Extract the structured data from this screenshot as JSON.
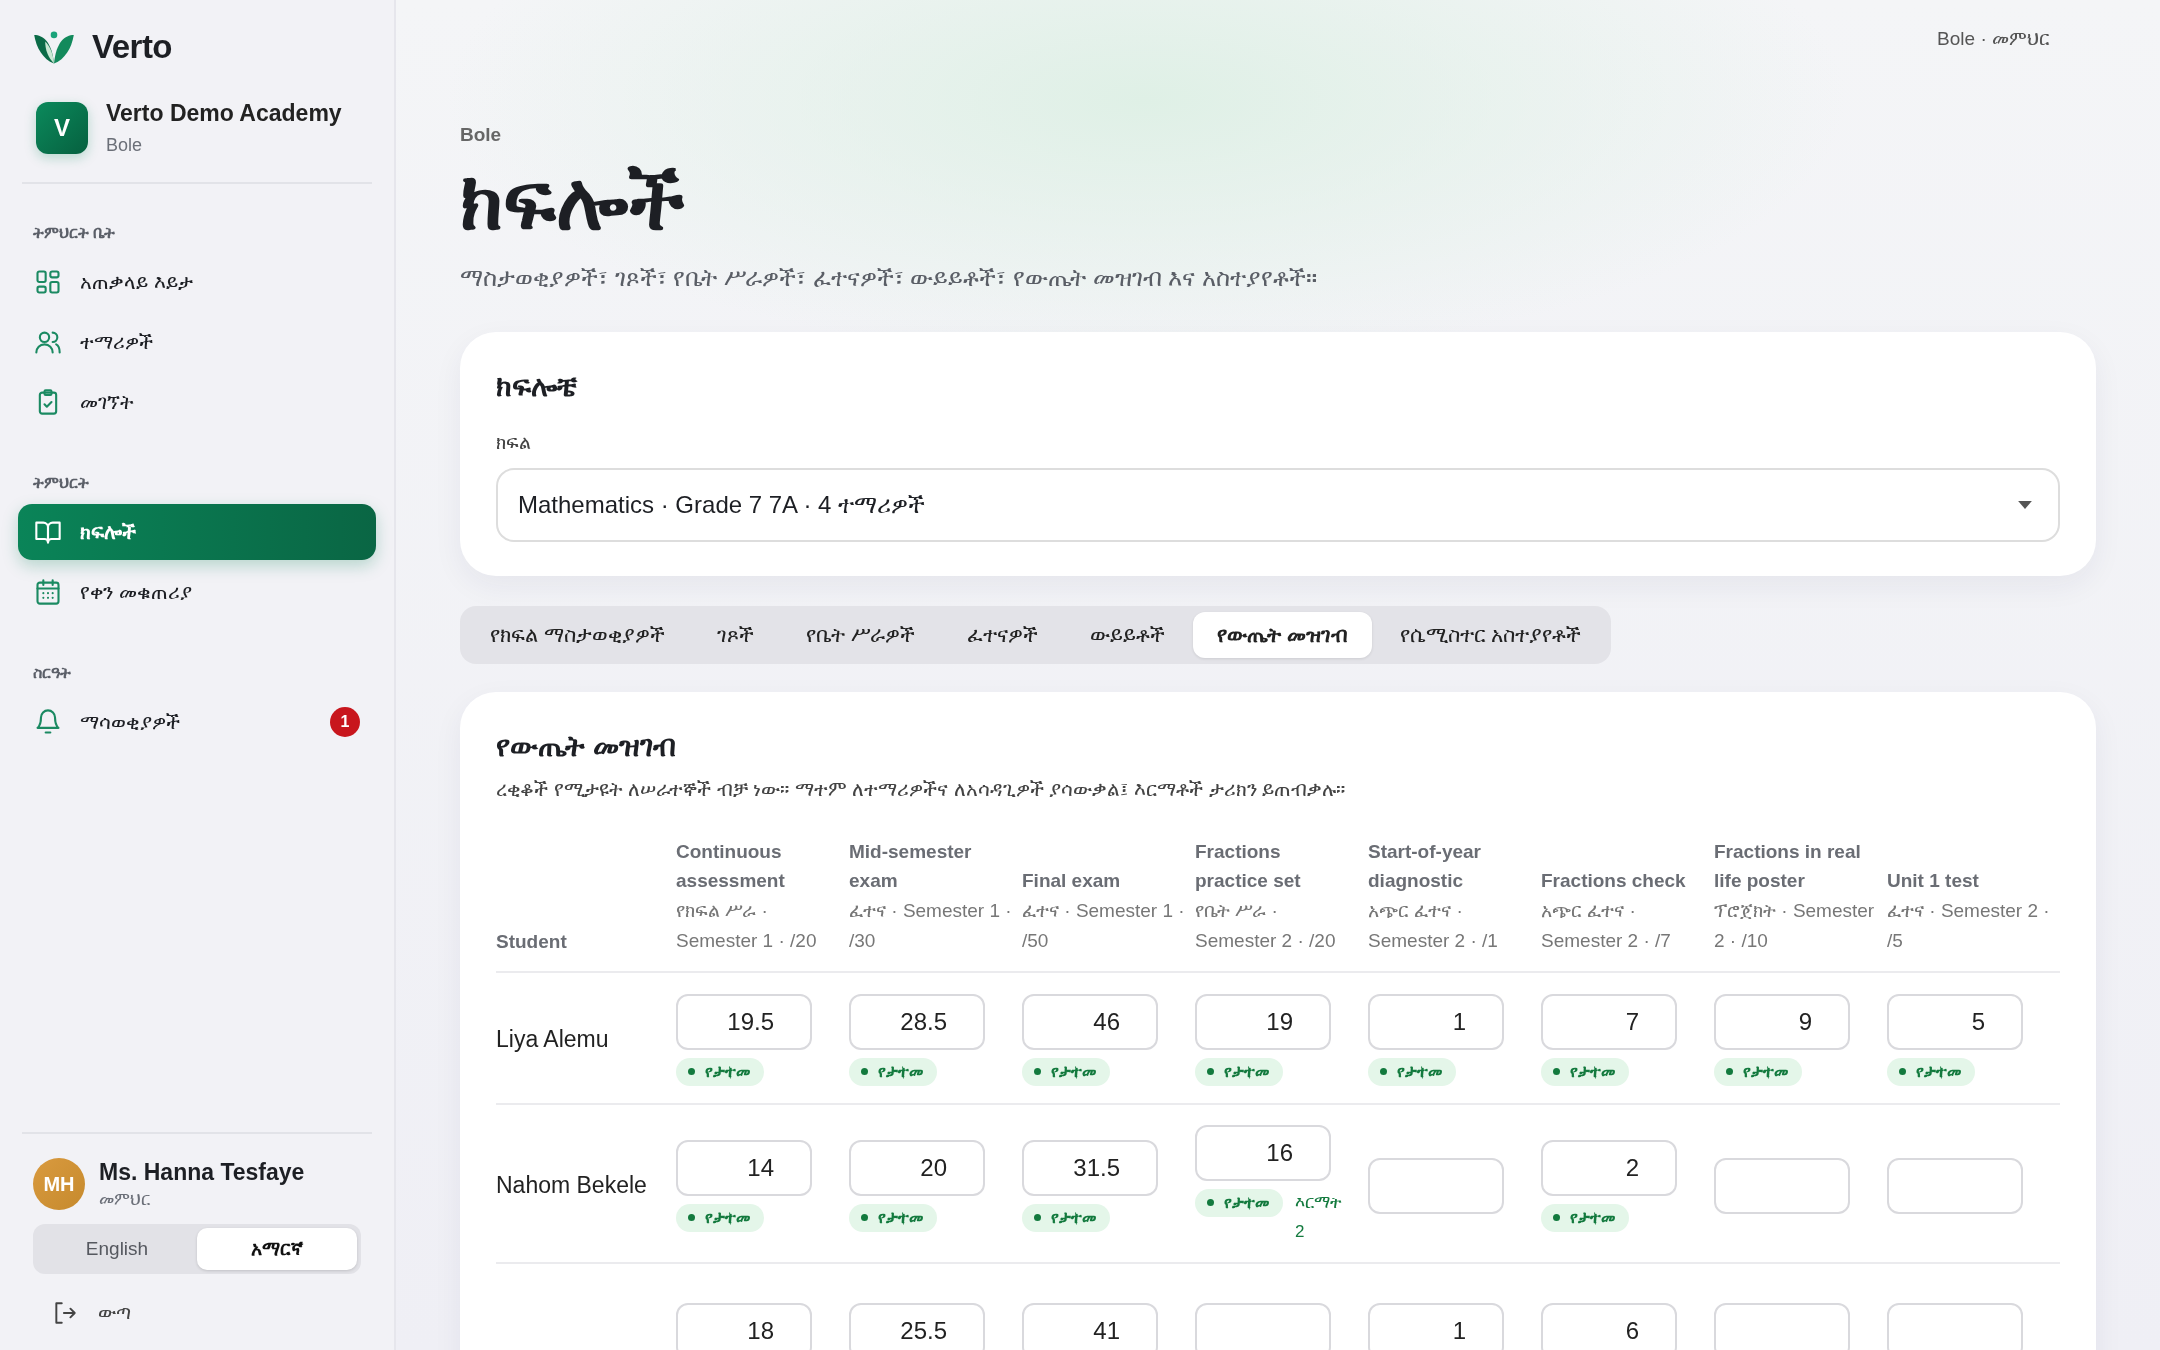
{
  "sidebar": {
    "brand": "Verto",
    "school": {
      "initial": "V",
      "name": "Verto Demo Academy",
      "branch": "Bole"
    },
    "sections": [
      {
        "label": "ትምህርት ቤት",
        "items": [
          {
            "label": "አጠቃላይ እይታ",
            "selected": false
          },
          {
            "label": "ተማሪዎች",
            "selected": false
          },
          {
            "label": "መገኘት",
            "selected": false
          }
        ]
      },
      {
        "label": "ትምህርት",
        "items": [
          {
            "label": "ክፍሎች",
            "selected": true
          },
          {
            "label": "የቀን መቁጠሪያ",
            "selected": false
          }
        ]
      },
      {
        "label": "ስርዓት",
        "items": [
          {
            "label": "ማሳወቂያዎች",
            "selected": false,
            "badge": "1"
          }
        ]
      }
    ],
    "user": {
      "initials": "MH",
      "name": "Ms. Hanna Tesfaye",
      "role": "መምህር"
    },
    "languages": [
      {
        "label": "English",
        "selected": false
      },
      {
        "label": "አማርኛ",
        "selected": true
      }
    ],
    "logout": "ውጣ"
  },
  "top_bar": {
    "context": "Bole · መምህር"
  },
  "header": {
    "breadcrumb": "Bole",
    "title": "ክፍሎች",
    "subtitle": "ማስታወቂያዎች፣ ገጾች፣ የቤት ሥራዎች፣ ፈተናዎች፣ ውይይቶች፣ የውጤት መዝገብ እና አስተያየቶች።"
  },
  "class_card": {
    "title": "ክፍሎቼ",
    "field_label": "ክፍል",
    "select_value": "Mathematics · Grade 7 7A · 4 ተማሪዎች"
  },
  "tabs": [
    {
      "label": "የክፍል ማስታወቂያዎች",
      "selected": false
    },
    {
      "label": "ገጾች",
      "selected": false
    },
    {
      "label": "የቤት ሥራዎች",
      "selected": false
    },
    {
      "label": "ፈተናዎች",
      "selected": false
    },
    {
      "label": "ውይይቶች",
      "selected": false
    },
    {
      "label": "የውጤት መዝገብ",
      "selected": true
    },
    {
      "label": "የሴሚስተር አስተያየቶች",
      "selected": false
    }
  ],
  "gradebook": {
    "title": "የውጤት መዝገብ",
    "note": "ረቂቆች የሚታዩት ለሠራተኞች ብቻ ነው። ማተም ለተማሪዎችና ለአሳዳጊዎች ያሳውቃል፤ እርማቶች ታሪክን ይጠብቃሉ።",
    "student_header": "Student",
    "columns": [
      {
        "title": "Continuous assessment",
        "meta": "የክፍል ሥራ · Semester 1 · /20"
      },
      {
        "title": "Mid-semester exam",
        "meta": "ፈተና · Semester 1 · /30"
      },
      {
        "title": "Final exam",
        "meta": "ፈተና · Semester 1 · /50"
      },
      {
        "title": "Fractions practice set",
        "meta": "የቤት ሥራ · Semester 2 · /20"
      },
      {
        "title": "Start-of-year diagnostic",
        "meta": "አጭር ፈተና · Semester 2 · /1"
      },
      {
        "title": "Fractions check",
        "meta": "አጭር ፈተና · Semester 2 · /7"
      },
      {
        "title": "Fractions in real life poster",
        "meta": "ፕሮጀክት · Semester 2 · /10"
      },
      {
        "title": "Unit 1 test",
        "meta": "ፈተና · Semester 2 · /5"
      }
    ],
    "rows": [
      {
        "student": "Liya Alemu",
        "cells": [
          {
            "value": "19.5",
            "status": "የታተመ"
          },
          {
            "value": "28.5",
            "status": "የታተመ"
          },
          {
            "value": "46",
            "status": "የታተመ"
          },
          {
            "value": "19",
            "status": "የታተመ"
          },
          {
            "value": "1",
            "status": "የታተመ"
          },
          {
            "value": "7",
            "status": "የታተመ"
          },
          {
            "value": "9",
            "status": "የታተመ"
          },
          {
            "value": "5",
            "status": "የታተመ"
          }
        ]
      },
      {
        "student": "Nahom Bekele",
        "cells": [
          {
            "value": "14",
            "status": "የታተመ"
          },
          {
            "value": "20",
            "status": "የታተመ"
          },
          {
            "value": "31.5",
            "status": "የታተመ"
          },
          {
            "value": "16",
            "status": "የታተመ",
            "note": "እርማት 2"
          },
          {},
          {
            "value": "2",
            "status": "የታተመ"
          },
          {},
          {}
        ]
      },
      {
        "cells": [
          {
            "value": "18"
          },
          {
            "value": "25.5"
          },
          {
            "value": "41"
          },
          {},
          {
            "value": "1"
          },
          {
            "value": "6"
          },
          {},
          {}
        ]
      }
    ]
  }
}
